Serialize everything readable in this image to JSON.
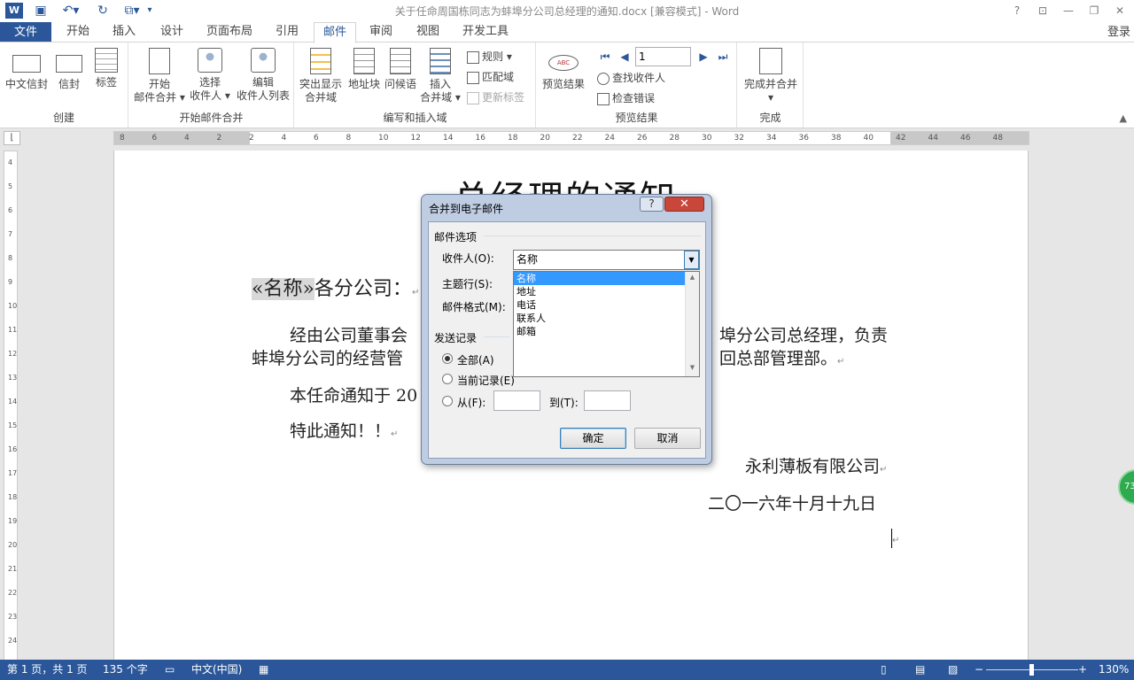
{
  "window": {
    "title": "关于任命周国栋同志为蚌埠分公司总经理的通知.docx [兼容模式] - Word",
    "login": "登录"
  },
  "tabs": {
    "file": "文件",
    "items": [
      "开始",
      "插入",
      "设计",
      "页面布局",
      "引用",
      "邮件",
      "审阅",
      "视图",
      "开发工具"
    ],
    "active": "邮件"
  },
  "ribbon": {
    "create": {
      "label": "创建",
      "btn1": "中文信封",
      "btn2": "信封",
      "btn3": "标签"
    },
    "start_merge": {
      "label": "开始邮件合并",
      "btn1_l1": "开始",
      "btn1_l2": "邮件合并",
      "btn2_l1": "选择",
      "btn2_l2": "收件人",
      "btn3_l1": "编辑",
      "btn3_l2": "收件人列表"
    },
    "write_insert": {
      "label": "编写和插入域",
      "btn1_l1": "突出显示",
      "btn1_l2": "合并域",
      "btn2": "地址块",
      "btn3": "问候语",
      "btn4_l1": "插入",
      "btn4_l2": "合并域",
      "rules": "规则",
      "match": "匹配域",
      "update": "更新标签"
    },
    "preview": {
      "label": "预览结果",
      "btn": "预览结果",
      "record": "1",
      "find": "查找收件人",
      "check": "检查错误"
    },
    "finish": {
      "label": "完成",
      "btn": "完成并合并"
    }
  },
  "ruler": {
    "h_ticks": [
      "8",
      "6",
      "4",
      "2",
      "2",
      "4",
      "6",
      "8",
      "10",
      "12",
      "14",
      "16",
      "18",
      "20",
      "22",
      "24",
      "26",
      "28",
      "30",
      "32",
      "34",
      "36",
      "38",
      "40",
      "42",
      "44",
      "46",
      "48"
    ],
    "v_ticks": [
      "4",
      "5",
      "6",
      "7",
      "8",
      "9",
      "10",
      "11",
      "12",
      "13",
      "14",
      "15",
      "16",
      "17",
      "18",
      "19",
      "20",
      "21",
      "22",
      "23",
      "24"
    ]
  },
  "document": {
    "title": "总经理的通知",
    "merge_field": "«名称»",
    "addressee_suffix": "各分公司：",
    "para1_start": "经由公司董事会",
    "para1_end": "埠分公司总经理，负责",
    "para2_start": "蚌埠分公司的经营管",
    "para2_end": "回总部管理部。",
    "para3": "本任命通知于 20",
    "para4": "特此通知！！",
    "company": "永利薄板有限公司",
    "date": "二〇一六年十月十九日",
    "para_mark": "↵"
  },
  "dialog": {
    "title": "合并到电子邮件",
    "help": "?",
    "close": "✕",
    "mail_options": "邮件选项",
    "recipient_label": "收件人(O):",
    "subject_label": "主题行(S):",
    "format_label": "邮件格式(M):",
    "recipient_value": "名称",
    "dropdown_options": [
      "名称",
      "地址",
      "电话",
      "联系人",
      "邮箱"
    ],
    "selected_option": "名称",
    "send_records": "发送记录",
    "all": "全部(A)",
    "current": "当前记录(E)",
    "from": "从(F):",
    "to": "到(T):",
    "ok": "确定",
    "cancel": "取消"
  },
  "status": {
    "page": "第 1 页，共 1 页",
    "words": "135 个字",
    "lang": "中文(中国)",
    "zoom": "130%",
    "zoom_level_percent": 130
  },
  "badge": "73",
  "colors": {
    "accent": "#2b579a",
    "selection": "#3399ff",
    "badge": "#2eaa4f"
  }
}
